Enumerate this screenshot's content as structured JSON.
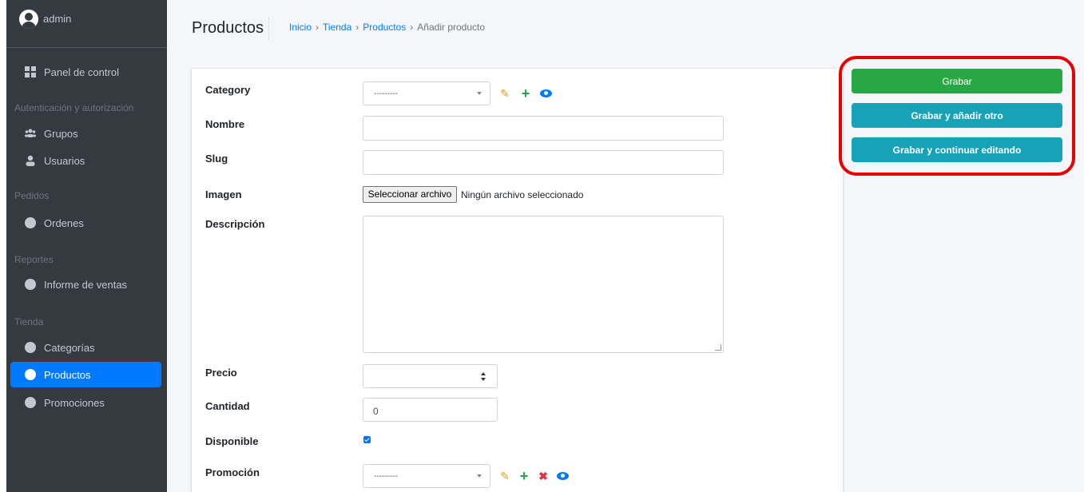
{
  "user": {
    "name": "admin",
    "avatar_icon": "user-circle-icon"
  },
  "sidebar": {
    "items": [
      {
        "label": "Panel de control",
        "icon": "dashboard-icon"
      },
      {
        "header": "Autenticación y autorización"
      },
      {
        "label": "Grupos",
        "icon": "users-icon"
      },
      {
        "label": "Usuarios",
        "icon": "user-icon"
      },
      {
        "header": "Pedidos"
      },
      {
        "label": "Ordenes",
        "icon": "circle-icon"
      },
      {
        "header": "Reportes"
      },
      {
        "label": "Informe de ventas",
        "icon": "circle-icon"
      },
      {
        "header": "Tienda"
      },
      {
        "label": "Categorías",
        "icon": "circle-icon"
      },
      {
        "label": "Productos",
        "icon": "circle-icon",
        "active": true
      },
      {
        "label": "Promociones",
        "icon": "circle-icon"
      }
    ]
  },
  "header": {
    "title": "Productos",
    "breadcrumb": [
      "Inicio",
      "Tienda",
      "Productos",
      "Añadir producto"
    ]
  },
  "form": {
    "category": {
      "label": "Category",
      "value": "---------"
    },
    "nombre": {
      "label": "Nombre",
      "value": ""
    },
    "slug": {
      "label": "Slug",
      "value": ""
    },
    "imagen": {
      "label": "Imagen",
      "button": "Seleccionar archivo",
      "status": "Ningún archivo seleccionado"
    },
    "descripcion": {
      "label": "Descripción",
      "value": ""
    },
    "precio": {
      "label": "Precio",
      "value": ""
    },
    "cantidad": {
      "label": "Cantidad",
      "value": "0"
    },
    "disponible": {
      "label": "Disponible",
      "checked": true
    },
    "promocion": {
      "label": "Promoción",
      "value": "---------"
    }
  },
  "actions": {
    "save": "Grabar",
    "save_add": "Grabar y añadir otro",
    "save_continue": "Grabar y continuar editando"
  },
  "colors": {
    "sidebar_bg": "#343a40",
    "active": "#007bff",
    "success": "#28a745",
    "info": "#17a2b8",
    "highlight": "#e60000"
  }
}
